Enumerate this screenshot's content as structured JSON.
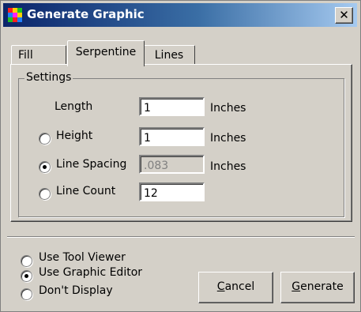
{
  "window": {
    "title": "Generate Graphic"
  },
  "tabs": [
    "Fill",
    "Serpentine",
    "Lines"
  ],
  "active_tab": "Serpentine",
  "settings": {
    "group_label": "Settings",
    "length": {
      "label": "Length",
      "value": "1",
      "unit": "Inches"
    },
    "height": {
      "label": "Height",
      "value": "1",
      "unit": "Inches",
      "selected": false
    },
    "line_spacing": {
      "label": "Line Spacing",
      "value": ".083",
      "unit": "Inches",
      "selected": true
    },
    "line_count": {
      "label": "Line Count",
      "value": "12",
      "selected": false
    }
  },
  "display_options": [
    {
      "label": "Use Tool Viewer",
      "selected": false
    },
    {
      "label": "Use Graphic Editor",
      "selected": true
    },
    {
      "label": "Don't Display",
      "selected": false
    }
  ],
  "buttons": {
    "cancel": {
      "accesskey": "C",
      "rest": "ancel"
    },
    "generate": {
      "accesskey": "G",
      "rest": "enerate"
    }
  }
}
